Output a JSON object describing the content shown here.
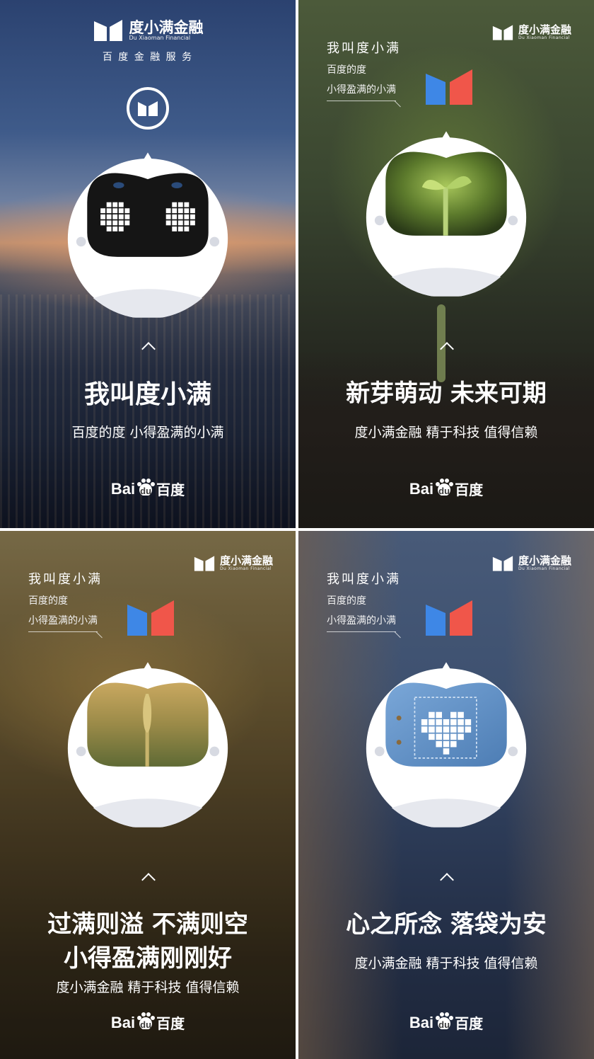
{
  "brand": {
    "name_cn": "度小满金融",
    "name_en": "Du Xiaoman Financial",
    "tagline_p1": "百 度 金 融 服 务"
  },
  "intro_caption": {
    "line1": "我叫度小满",
    "line2": "百度的度",
    "line3": "小得盈满的小满"
  },
  "footer_logo": {
    "latin_prefix": "Bai",
    "latin_mark": "du",
    "chinese": "百度"
  },
  "panels": [
    {
      "headline": "我叫度小满",
      "subtitle": "百度的度 小得盈满的小满"
    },
    {
      "headline": "新芽萌动 未来可期",
      "subtitle": "度小满金融 精于科技 值得信赖"
    },
    {
      "headline_line1": "过满则溢 不满则空",
      "headline_line2": "小得盈满刚刚好",
      "subtitle": "度小满金融 精于科技 值得信赖"
    },
    {
      "headline": "心之所念 落袋为安",
      "subtitle": "度小满金融 精于科技 值得信赖"
    }
  ],
  "icons": [
    "brand-logo-icon",
    "robot-mascot-icon",
    "chevron-up-icon",
    "paw-icon"
  ],
  "colors": {
    "logo_blue": "#3e87e6",
    "logo_red": "#f0564a",
    "robot_white": "#ffffff",
    "robot_gray": "#d7dae2",
    "screen_dark": "#151515"
  }
}
